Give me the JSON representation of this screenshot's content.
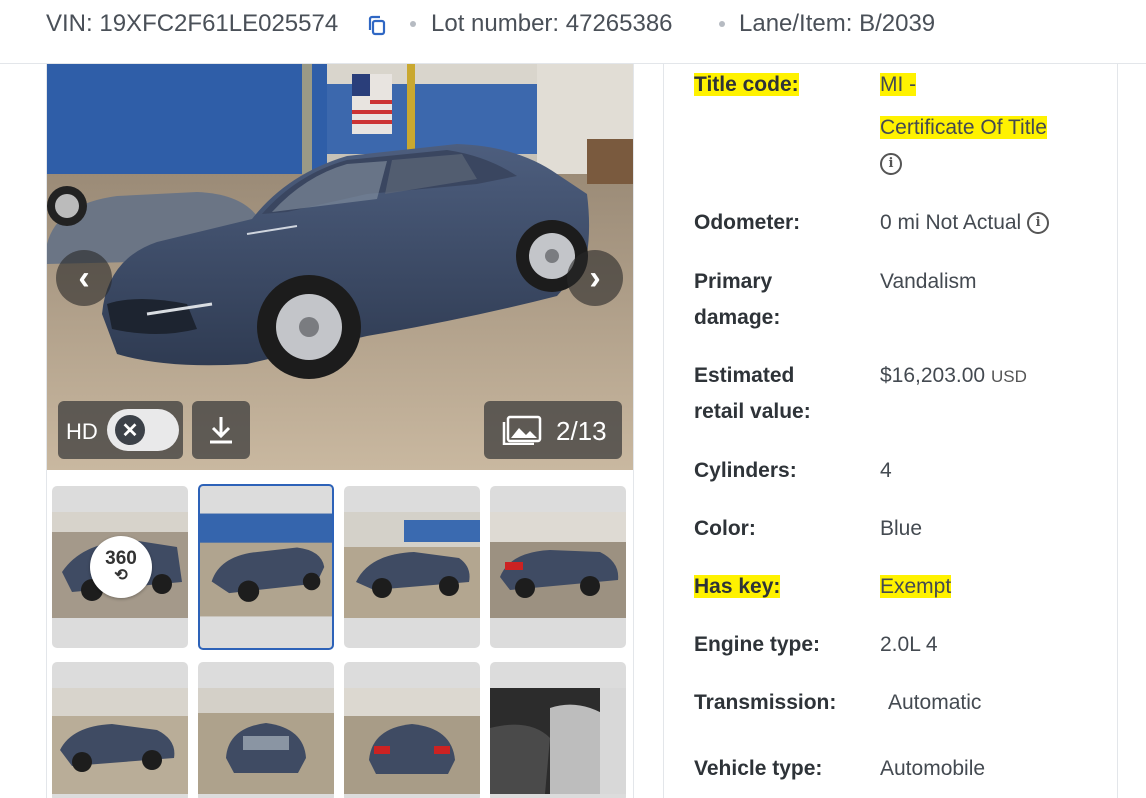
{
  "header": {
    "vin_label": "VIN:",
    "vin": "19XFC2F61LE025574",
    "lot_label": "Lot number:",
    "lot": "47265386",
    "lane_label": "Lane/Item:",
    "lane": "B/2039"
  },
  "gallery": {
    "hd_label": "HD",
    "counter": "2/13",
    "badge_360": "360",
    "icons": [
      "chevron-left-icon",
      "chevron-right-icon",
      "close-icon",
      "download-icon",
      "gallery-icon",
      "rotate-360-icon",
      "copy-icon"
    ]
  },
  "details": [
    {
      "label": "Title code:",
      "value": "MI -",
      "value2": "Certificate Of Title",
      "highlight": true
    },
    {
      "label": "Odometer:",
      "value": "0 mi Not Actual"
    },
    {
      "label": "Primary damage:",
      "value": "Vandalism"
    },
    {
      "label": "Estimated retail value:",
      "value": "$16,203.00",
      "unit": "USD"
    },
    {
      "label": "Cylinders:",
      "value": "4"
    },
    {
      "label": "Color:",
      "value": "Blue"
    },
    {
      "label": "Has key:",
      "value": "Exempt",
      "highlight": true
    },
    {
      "label": "Engine type:",
      "value": "2.0L 4"
    },
    {
      "label": "Transmission:",
      "value": "Automatic"
    },
    {
      "label": "Vehicle type:",
      "value": "Automobile"
    }
  ],
  "colors": {
    "highlight": "#fff200",
    "accent_border": "#2d62b8",
    "car_body": "#3b4a66"
  }
}
